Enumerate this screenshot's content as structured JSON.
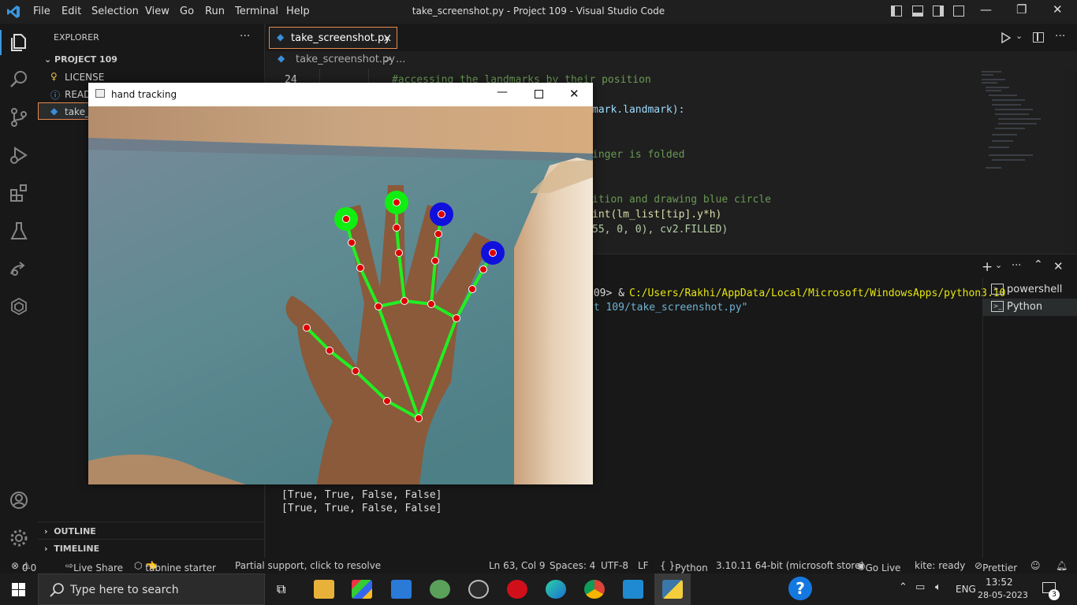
{
  "titlebar": {
    "menu": [
      "File",
      "Edit",
      "Selection",
      "View",
      "Go",
      "Run",
      "Terminal",
      "Help"
    ],
    "title": "take_screenshot.py - Project 109 - Visual Studio Code"
  },
  "sidebar": {
    "header": "EXPLORER",
    "more": "···",
    "project": "PROJECT 109",
    "files": [
      "LICENSE",
      "READ",
      "take_"
    ],
    "outline": "OUTLINE",
    "timeline": "TIMELINE"
  },
  "editor": {
    "tab_label": "take_screenshot.py",
    "tab_close": "×",
    "breadcrumb_file": "take_screenshot.py",
    "breadcrumb_sep": "> ...",
    "line_number": "24",
    "lines": [
      "#accessing the landmarks by their position",
      "mark.landmark):",
      "inger is folded",
      "ition and drawing blue circle",
      "int(lm_list[tip].y*h)",
      "55, 0, 0), cv2.FILLED)"
    ]
  },
  "panel": {
    "prompt_tail": "109> & ",
    "python_path": "C:/Users/Rakhi/AppData/Local/Microsoft/WindowsApps/python3.10",
    "script_path": "ct 109/take_screenshot.py\"",
    "output": [
      "[True, True, False, False]",
      "[True, True, False, False]"
    ],
    "terminals": [
      "powershell",
      "Python"
    ]
  },
  "hand_window": {
    "title": "hand tracking"
  },
  "statusbar": {
    "errors": "0",
    "warnings": "0",
    "live_share": "Live Share",
    "tabnine": "tabnine starter",
    "support": "Partial support, click to resolve",
    "position": "Ln 63, Col 9",
    "spaces": "Spaces: 4",
    "encoding": "UTF-8",
    "eol": "LF",
    "language": "Python",
    "interpreter": "3.10.11 64-bit (microsoft store)",
    "go_live": "Go Live",
    "kite": "kite: ready",
    "prettier": "Prettier"
  },
  "taskbar": {
    "search_placeholder": "Type here to search",
    "lang": "ENG",
    "time": "13:52",
    "date": "28-05-2023",
    "notifications": "3"
  },
  "colors": {
    "accent_tab_border": "#e8894d",
    "landmark_line": "#22ee22",
    "landmark_point": "#dd0000",
    "open_tip": "#11ee11",
    "folded_tip": "#1010dd",
    "vscode_blue": "#3a96dd"
  }
}
